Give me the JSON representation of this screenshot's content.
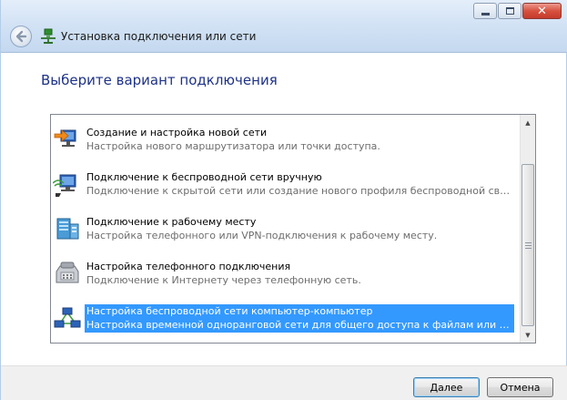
{
  "window": {
    "title": "Установка подключения или сети"
  },
  "heading": "Выберите вариант подключения",
  "options": [
    {
      "title": "Создание и настройка новой сети",
      "description": "Настройка нового маршрутизатора или точки доступа.",
      "icon": "new-network-icon",
      "selected": false
    },
    {
      "title": "Подключение к беспроводной сети вручную",
      "description": "Подключение к скрытой сети или создание нового профиля беспроводной связи.",
      "icon": "wireless-network-icon",
      "selected": false
    },
    {
      "title": "Подключение к рабочему месту",
      "description": "Настройка телефонного или VPN-подключения к рабочему месту.",
      "icon": "workplace-icon",
      "selected": false
    },
    {
      "title": "Настройка телефонного подключения",
      "description": "Подключение к Интернету через телефонную сеть.",
      "icon": "dialup-phone-icon",
      "selected": false
    },
    {
      "title": "Настройка беспроводной сети компьютер-компьютер",
      "description": "Настройка временной одноранговой сети для общего доступа к файлам или к Инт...",
      "icon": "adhoc-network-icon",
      "selected": true
    }
  ],
  "buttons": {
    "next": "Далее",
    "cancel": "Отмена"
  },
  "colors": {
    "selection": "#3399ff",
    "heading": "#1e3287",
    "titlebar": "#d3e3f5"
  }
}
